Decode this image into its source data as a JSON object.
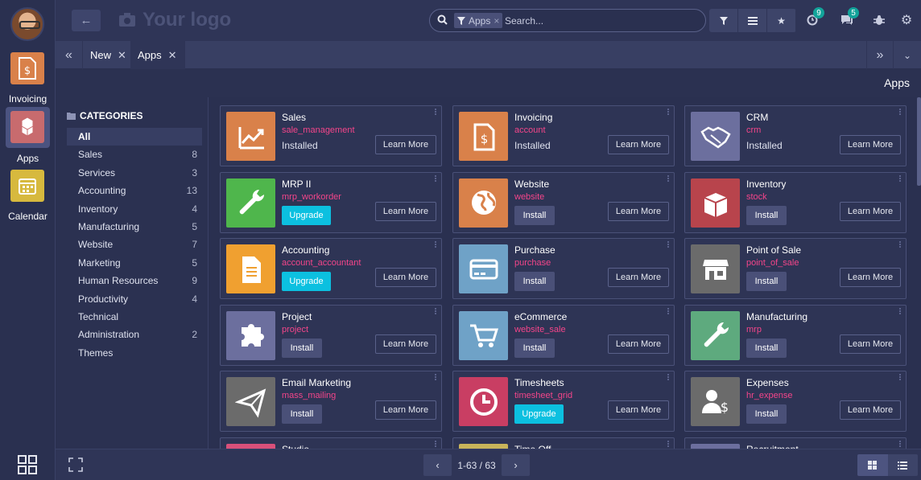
{
  "sidebar_apps": [
    {
      "label": "Invoicing",
      "icon": "invoice-dollar-icon",
      "color": "#d9814a"
    },
    {
      "label": "Apps",
      "icon": "cubes-icon",
      "color": "#c86b6e"
    },
    {
      "label": "Calendar",
      "icon": "calendar-icon",
      "color": "#d7b93e"
    }
  ],
  "topbar": {
    "logo_text": "Your logo",
    "search_facet": "Apps",
    "search_placeholder": "Search...",
    "activity_badge": "9",
    "messages_badge": "5"
  },
  "tabs": [
    {
      "label": "New"
    },
    {
      "label": "Apps"
    }
  ],
  "page_title": "Apps",
  "categories": {
    "heading": "CATEGORIES",
    "items": [
      {
        "label": "All",
        "count": ""
      },
      {
        "label": "Sales",
        "count": "8"
      },
      {
        "label": "Services",
        "count": "3"
      },
      {
        "label": "Accounting",
        "count": "13"
      },
      {
        "label": "Inventory",
        "count": "4"
      },
      {
        "label": "Manufacturing",
        "count": "5"
      },
      {
        "label": "Website",
        "count": "7"
      },
      {
        "label": "Marketing",
        "count": "5"
      },
      {
        "label": "Human Resources",
        "count": "9"
      },
      {
        "label": "Productivity",
        "count": "4"
      },
      {
        "label": "Technical",
        "count": ""
      },
      {
        "label": "Administration",
        "count": "2"
      },
      {
        "label": "Themes",
        "count": ""
      }
    ]
  },
  "learn_more_label": "Learn More",
  "apps": [
    {
      "name": "Sales",
      "module": "sale_management",
      "state": "Installed",
      "action": "",
      "color": "#d9814a",
      "icon": "chart-line-icon"
    },
    {
      "name": "Invoicing",
      "module": "account",
      "state": "Installed",
      "action": "",
      "color": "#d9814a",
      "icon": "invoice-dollar-icon"
    },
    {
      "name": "CRM",
      "module": "crm",
      "state": "Installed",
      "action": "",
      "color": "#6c6f9e",
      "icon": "handshake-icon"
    },
    {
      "name": "MRP II",
      "module": "mrp_workorder",
      "state": "",
      "action": "Upgrade",
      "color": "#4fb64c",
      "icon": "wrench-icon"
    },
    {
      "name": "Website",
      "module": "website",
      "state": "",
      "action": "Install",
      "color": "#d9814a",
      "icon": "globe-icon"
    },
    {
      "name": "Inventory",
      "module": "stock",
      "state": "",
      "action": "Install",
      "color": "#b8444c",
      "icon": "box-icon"
    },
    {
      "name": "Accounting",
      "module": "account_accountant",
      "state": "",
      "action": "Upgrade",
      "color": "#f0a030",
      "icon": "document-icon"
    },
    {
      "name": "Purchase",
      "module": "purchase",
      "state": "",
      "action": "Install",
      "color": "#6fa2c7",
      "icon": "credit-card-icon"
    },
    {
      "name": "Point of Sale",
      "module": "point_of_sale",
      "state": "",
      "action": "Install",
      "color": "#6b6b6b",
      "icon": "shop-icon"
    },
    {
      "name": "Project",
      "module": "project",
      "state": "",
      "action": "Install",
      "color": "#6c6f9e",
      "icon": "puzzle-icon"
    },
    {
      "name": "eCommerce",
      "module": "website_sale",
      "state": "",
      "action": "Install",
      "color": "#6fa2c7",
      "icon": "cart-icon"
    },
    {
      "name": "Manufacturing",
      "module": "mrp",
      "state": "",
      "action": "Install",
      "color": "#5eaa7e",
      "icon": "wrench-icon"
    },
    {
      "name": "Email Marketing",
      "module": "mass_mailing",
      "state": "",
      "action": "Install",
      "color": "#6b6b6b",
      "icon": "paper-plane-icon"
    },
    {
      "name": "Timesheets",
      "module": "timesheet_grid",
      "state": "",
      "action": "Upgrade",
      "color": "#c93e63",
      "icon": "clock-icon"
    },
    {
      "name": "Expenses",
      "module": "hr_expense",
      "state": "",
      "action": "Install",
      "color": "#6b6b6b",
      "icon": "user-dollar-icon"
    },
    {
      "name": "Studio",
      "module": "",
      "state": "",
      "action": "",
      "color": "#d9507a",
      "icon": "studio-icon"
    },
    {
      "name": "Time Off",
      "module": "",
      "state": "",
      "action": "",
      "color": "#c8b45a",
      "icon": "time-off-icon"
    },
    {
      "name": "Recruitment",
      "module": "",
      "state": "",
      "action": "",
      "color": "#6c6f9e",
      "icon": "recruitment-icon"
    }
  ],
  "pager": {
    "text": "1-63 / 63"
  }
}
